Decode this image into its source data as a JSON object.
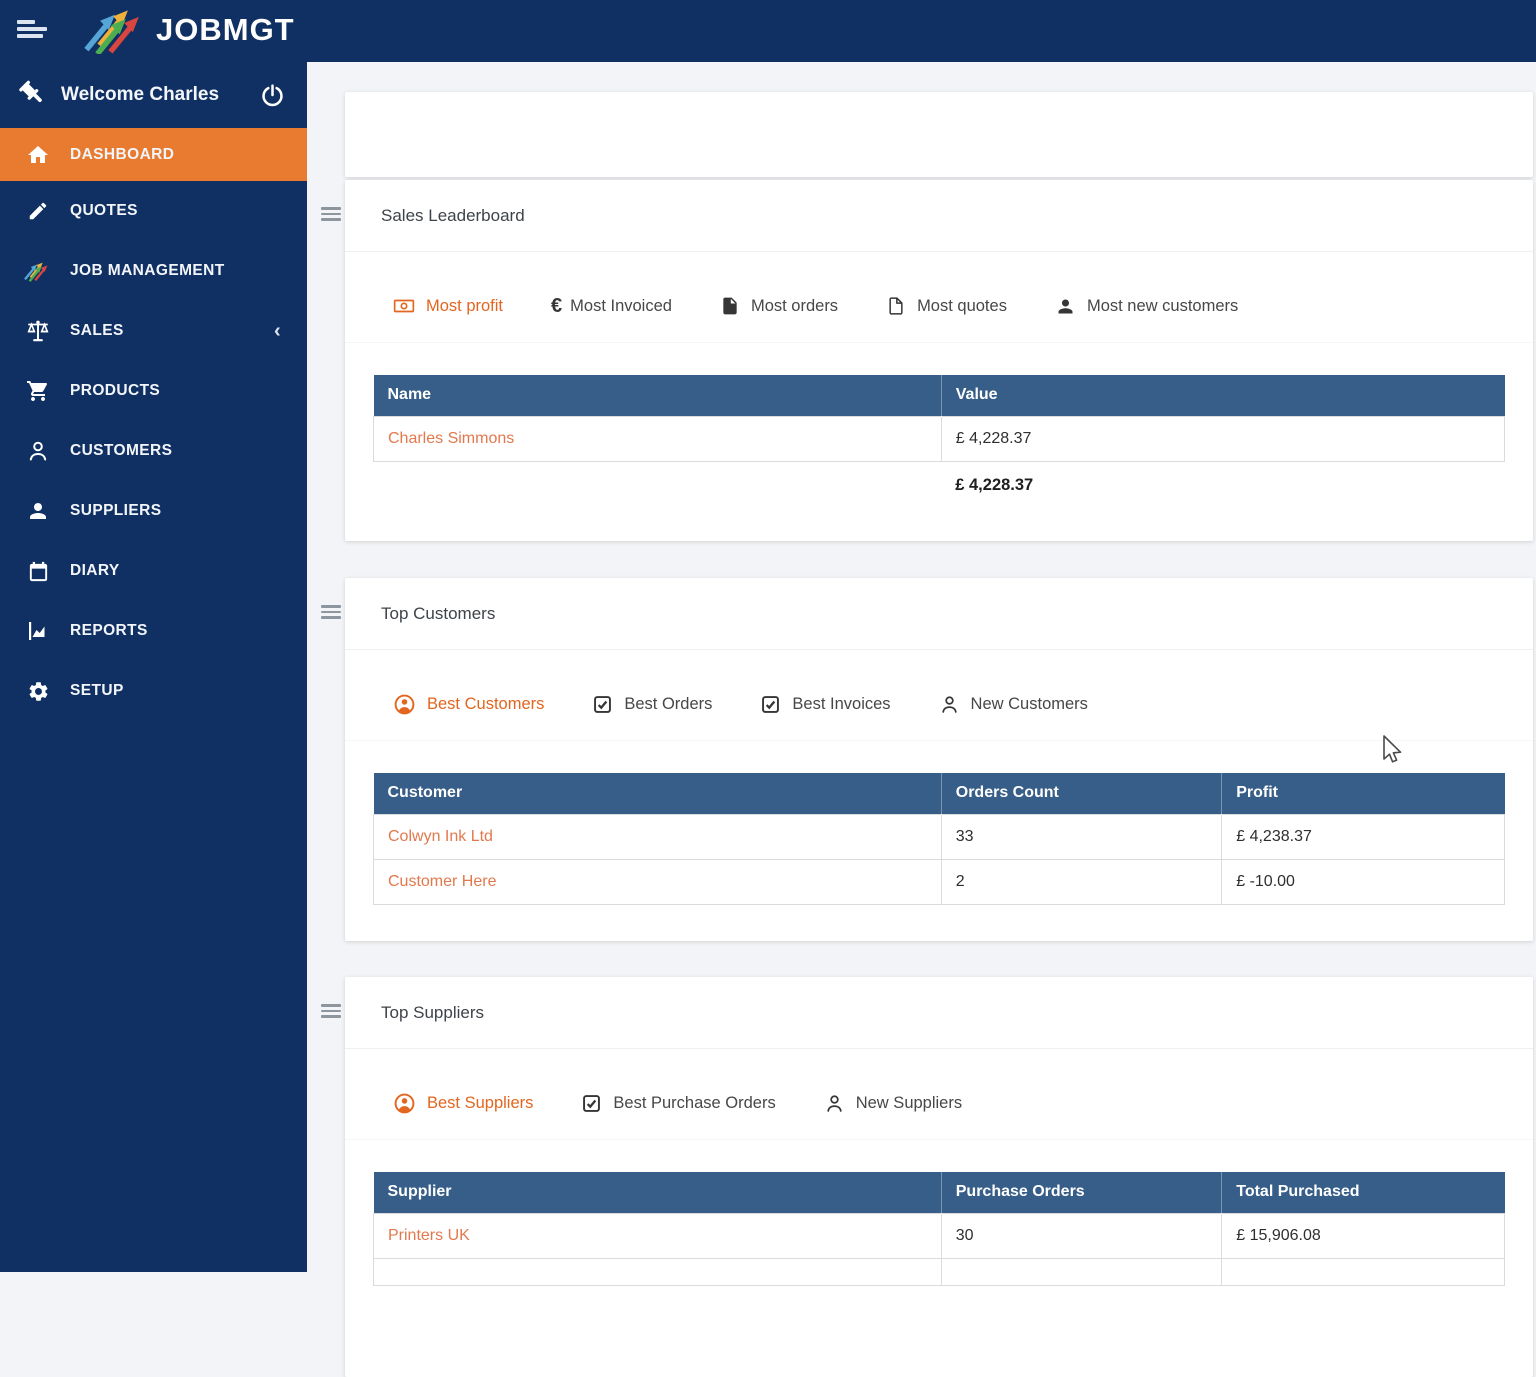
{
  "topbar": {
    "logo": "JOBMGT"
  },
  "sidebar": {
    "welcome_label": "Welcome Charles",
    "sales_chevron": "‹",
    "items": [
      {
        "label": "DASHBOARD"
      },
      {
        "label": "QUOTES"
      },
      {
        "label": "JOB MANAGEMENT"
      },
      {
        "label": "SALES"
      },
      {
        "label": "PRODUCTS"
      },
      {
        "label": "CUSTOMERS"
      },
      {
        "label": "SUPPLIERS"
      },
      {
        "label": "DIARY"
      },
      {
        "label": "REPORTS"
      },
      {
        "label": "SETUP"
      }
    ]
  },
  "panels": {
    "sales": {
      "title": "Sales Leaderboard",
      "euro_symbol": "€",
      "tabs": [
        "Most profit",
        "Most Invoiced",
        "Most orders",
        "Most quotes",
        "Most new customers"
      ],
      "table": {
        "col_name": "Name",
        "col_value": "Value",
        "row_name": "Charles Simmons",
        "row_value": "£ 4,228.37",
        "total": "£ 4,228.37"
      }
    },
    "customers": {
      "title": "Top Customers",
      "tabs": [
        "Best Customers",
        "Best Orders",
        "Best Invoices",
        "New Customers"
      ],
      "table": {
        "col_customer": "Customer",
        "col_orders": "Orders Count",
        "col_profit": "Profit",
        "rows": [
          {
            "customer": "Colwyn Ink Ltd",
            "orders": "33",
            "profit": "£ 4,238.37"
          },
          {
            "customer": "Customer Here",
            "orders": "2",
            "profit": "£ -10.00"
          }
        ]
      }
    },
    "suppliers": {
      "title": "Top Suppliers",
      "tabs": [
        "Best Suppliers",
        "Best Purchase Orders",
        "New Suppliers"
      ],
      "table": {
        "col_supplier": "Supplier",
        "col_po": "Purchase Orders",
        "col_total": "Total Purchased",
        "rows": [
          {
            "supplier": "Printers UK",
            "po": "30",
            "total": "£ 15,906.08"
          }
        ]
      }
    }
  },
  "colors": {
    "navy": "#103063",
    "orange_active_item": "#e87b2f",
    "table_header_blue": "#375e88",
    "link_orange": "#e2794d",
    "active_tab_orange": "#e2661f"
  }
}
